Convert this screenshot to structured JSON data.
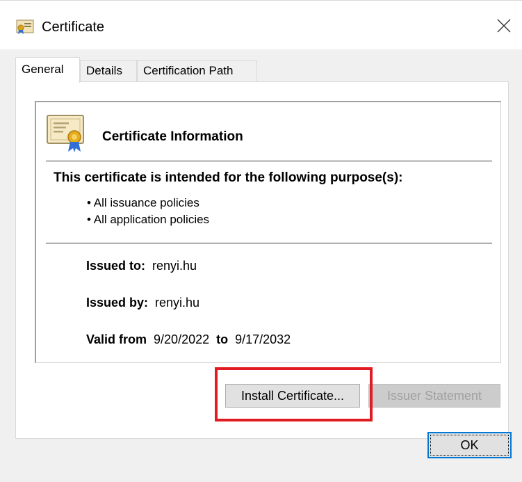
{
  "window": {
    "title": "Certificate",
    "title_icon": "certificate-icon",
    "close_icon": "close-icon"
  },
  "tabs": [
    {
      "label": "General",
      "active": true
    },
    {
      "label": "Details",
      "active": false
    },
    {
      "label": "Certification Path",
      "active": false
    }
  ],
  "info": {
    "icon": "certificate-ribbon-icon",
    "title": "Certificate Information",
    "purpose_heading": "This certificate is intended for the following purpose(s):",
    "purposes": [
      "• All issuance policies",
      "• All application policies"
    ],
    "issued_to_label": "Issued to:",
    "issued_to_value": "renyi.hu",
    "issued_by_label": "Issued by:",
    "issued_by_value": "renyi.hu",
    "valid_from_label": "Valid from",
    "valid_from_value": "9/20/2022",
    "valid_to_label": "to",
    "valid_to_value": "9/17/2032"
  },
  "buttons": {
    "install": "Install Certificate...",
    "issuer_statement": "Issuer Statement",
    "ok": "OK"
  },
  "colors": {
    "highlight": "#e11b22",
    "focus_border": "#0078d7"
  }
}
